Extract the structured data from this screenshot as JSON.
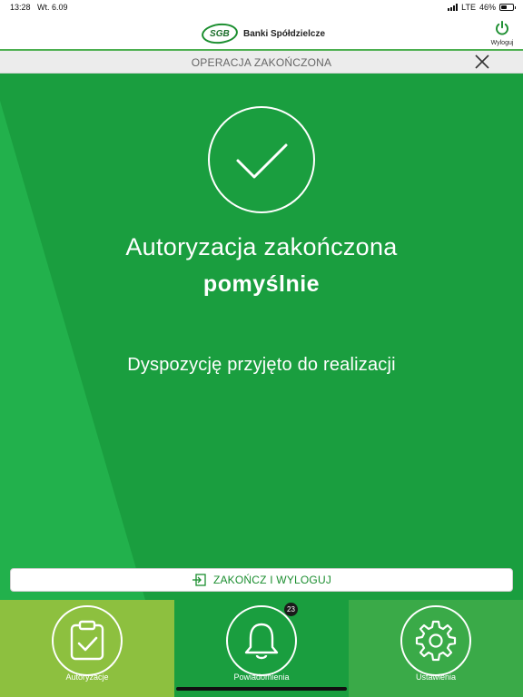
{
  "status_bar": {
    "time": "13:28",
    "date": "Wt. 6.09",
    "network": "LTE",
    "battery": "46%",
    "battery_level": 0.46
  },
  "header": {
    "logo_mark": "SGB",
    "logo_text": "Banki Spółdzielcze",
    "logout_label": "Wyloguj",
    "logout_icon": "power-icon"
  },
  "title_bar": {
    "title": "OPERACJA ZAKOŃCZONA",
    "close_icon": "close-icon"
  },
  "main": {
    "success_icon": "check-icon",
    "headline_line1": "Autoryzacja zakończona",
    "headline_line2": "pomyślnie",
    "message": "Dyspozycję przyjęto do realizacji"
  },
  "finish_button": {
    "label": "ZAKOŃCZ I WYLOGUJ",
    "icon": "exit-icon"
  },
  "bottom_nav": {
    "tabs": [
      {
        "label": "Autoryzacje",
        "icon": "clipboard-check-icon",
        "active": true
      },
      {
        "label": "Powiadomienia",
        "icon": "bell-icon",
        "badge": "23"
      },
      {
        "label": "Ustawienia",
        "icon": "gear-icon"
      }
    ]
  },
  "colors": {
    "primary_green": "#1a9e3f",
    "light_green": "#22b14c",
    "active_tab": "#8dc03f",
    "settings_tab": "#3aaa48"
  }
}
